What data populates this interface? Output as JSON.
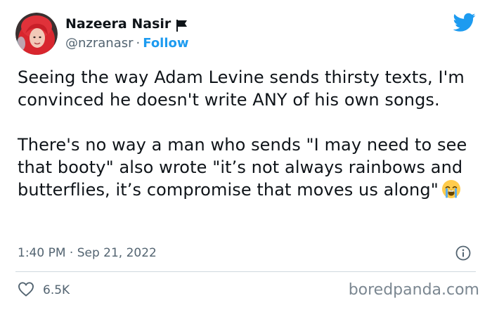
{
  "author": {
    "name": "Nazeera Nasir",
    "handle": "@nzranasr",
    "separator": "·",
    "follow_label": "Follow",
    "flag_icon": "black-flag-icon"
  },
  "platform_icon": "twitter-bird-icon",
  "tweet": {
    "paragraphs": [
      "Seeing the way Adam Levine sends thirsty texts, I'm convinced he doesn't write ANY of his own songs.",
      "There's no way a man who sends \"I may need to see that booty\" also wrote \"it’s not always rainbows and butterflies, it’s compromise that moves us along\""
    ],
    "emoji": "loudly-crying-face-emoji"
  },
  "meta": {
    "timestamp": "1:40 PM · Sep 21, 2022",
    "info_icon": "info-icon"
  },
  "engagement": {
    "like_icon": "heart-icon",
    "likes": "6.5K"
  },
  "watermark": "boredpanda.com",
  "colors": {
    "accent": "#1d9bf0",
    "text": "#0f1419",
    "secondary": "#536471",
    "divider": "#cfd9de"
  }
}
